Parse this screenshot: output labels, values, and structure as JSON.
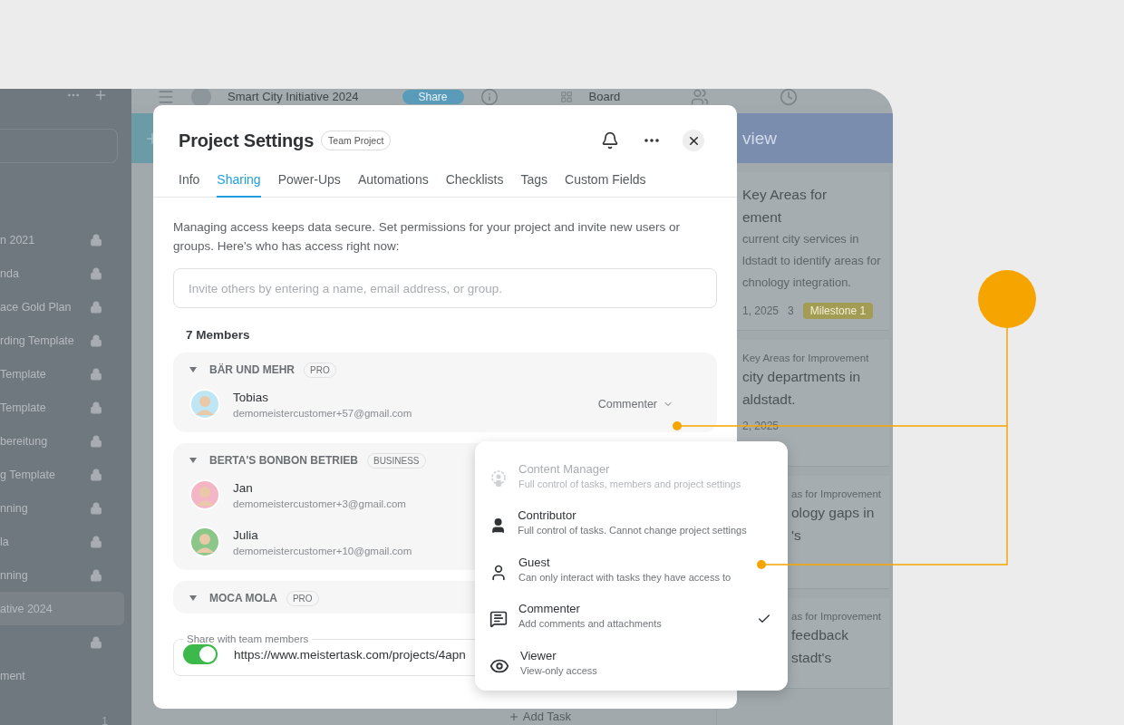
{
  "sidebar": {
    "items": [
      {
        "label": "n 2021",
        "locked": true,
        "selected": false
      },
      {
        "label": "nda",
        "locked": true,
        "selected": false
      },
      {
        "label": "ace Gold Plan",
        "locked": true,
        "selected": false
      },
      {
        "label": "rding Template",
        "locked": true,
        "selected": false
      },
      {
        "label": "Template",
        "locked": true,
        "selected": false
      },
      {
        "label": "Template",
        "locked": true,
        "selected": false
      },
      {
        "label": "bereitung",
        "locked": true,
        "selected": false
      },
      {
        "label": "g Template",
        "locked": true,
        "selected": false
      },
      {
        "label": "nning",
        "locked": true,
        "selected": false
      },
      {
        "label": "la",
        "locked": true,
        "selected": false
      },
      {
        "label": "nning",
        "locked": true,
        "selected": false
      },
      {
        "label": "ative 2024",
        "locked": false,
        "selected": true
      },
      {
        "locked": true,
        "selected": false
      },
      {
        "label": "ment",
        "locked": false,
        "selected": false
      }
    ],
    "footer_count": "1"
  },
  "topbar": {
    "project": "Smart City Initiative 2024",
    "share": "Share",
    "view": "Board"
  },
  "board": {
    "column_title": "view",
    "add_task": "Add Task",
    "cards": [
      {
        "title": [
          "Key Areas for",
          "ement"
        ],
        "description": [
          "current city services in",
          "ldstadt to identify areas for",
          "chnology integration."
        ],
        "date": "1, 2025",
        "subtasks": "3",
        "tag": "Milestone 1"
      },
      {
        "category": "Key Areas for Improvement",
        "title": [
          "city departments in",
          "aldstadt."
        ],
        "date": "2, 2025"
      },
      {
        "category": "as for Improvement",
        "title": [
          "ology gaps in",
          "'s"
        ]
      },
      {
        "category": "as for Improvement",
        "title": [
          "feedback",
          "stadt's"
        ]
      }
    ]
  },
  "dialog": {
    "title": "Project Settings",
    "badge": "Team Project",
    "tabs": [
      {
        "label": "Info",
        "selected": false
      },
      {
        "label": "Sharing",
        "selected": true
      },
      {
        "label": "Power-Ups",
        "selected": false
      },
      {
        "label": "Automations",
        "selected": false
      },
      {
        "label": "Checklists",
        "selected": false
      },
      {
        "label": "Tags",
        "selected": false
      },
      {
        "label": "Custom Fields",
        "selected": false
      }
    ],
    "intro": "Managing access keeps data secure. Set permissions for your project and invite new users or groups. Here's who has access right now:",
    "invite": {
      "placeholder": "Invite others by entering a name, email address, or group."
    },
    "members_count": "7 Members",
    "groups": [
      {
        "name": "BÄR UND MEHR",
        "plan": "PRO",
        "members": [
          {
            "name": "Tobias",
            "email": "demomeistercustomer+57@gmail.com",
            "role": "Commenter"
          }
        ]
      },
      {
        "name": "BERTA'S BONBON BETRIEB",
        "plan": "BUSINESS",
        "members": [
          {
            "name": "Jan",
            "email": "demomeistercustomer+3@gmail.com"
          },
          {
            "name": "Julia",
            "email": "demomeistercustomer+10@gmail.com"
          }
        ]
      },
      {
        "name": "MOCA MOLA",
        "plan": "PRO"
      }
    ],
    "share": {
      "legend": "Share with team members",
      "on": true,
      "url": "https://www.meistertask.com/projects/4apn"
    }
  },
  "role_menu": [
    {
      "kind": "manager",
      "title": "Content Manager",
      "description": "Full control of tasks, members and project settings",
      "disabled": true,
      "selected": false
    },
    {
      "kind": "contributor",
      "title": "Contributor",
      "description": "Full control of tasks. Cannot change project settings",
      "disabled": false,
      "selected": false
    },
    {
      "kind": "guest",
      "title": "Guest",
      "description": "Can only interact with tasks they have access to",
      "disabled": false,
      "selected": false
    },
    {
      "kind": "commenter",
      "title": "Commenter",
      "description": "Add comments and attachments",
      "disabled": false,
      "selected": true
    },
    {
      "kind": "viewer",
      "title": "Viewer",
      "description": "View-only access",
      "disabled": false,
      "selected": false
    }
  ]
}
